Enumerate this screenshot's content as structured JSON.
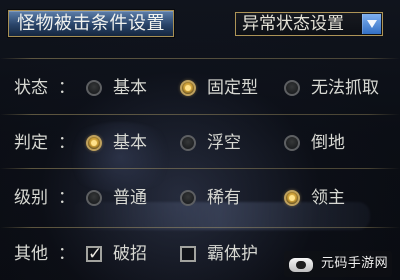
{
  "header": {
    "title": "怪物被击条件设置",
    "dropdown_value": "异常状态设置"
  },
  "rows": {
    "state": {
      "label": "状态",
      "colon": "：",
      "options": [
        {
          "label": "基本",
          "selected": false
        },
        {
          "label": "固定型",
          "selected": true
        },
        {
          "label": "无法抓取",
          "selected": false
        }
      ]
    },
    "judge": {
      "label": "判定",
      "colon": "：",
      "options": [
        {
          "label": "基本",
          "selected": true
        },
        {
          "label": "浮空",
          "selected": false
        },
        {
          "label": "倒地",
          "selected": false
        }
      ]
    },
    "level": {
      "label": "级别",
      "colon": "：",
      "options": [
        {
          "label": "普通",
          "selected": false
        },
        {
          "label": "稀有",
          "selected": false
        },
        {
          "label": "领主",
          "selected": true
        }
      ]
    },
    "other": {
      "label": "其他",
      "colon": "：",
      "options": [
        {
          "label": "破招",
          "checked": true
        },
        {
          "label": "霸体护",
          "checked": false
        }
      ]
    }
  },
  "watermark": {
    "text": "元码手游网"
  },
  "colors": {
    "accent_gold": "#bfa15d",
    "title_blue": "#294469",
    "dropdown_blue": "#336fc4"
  }
}
